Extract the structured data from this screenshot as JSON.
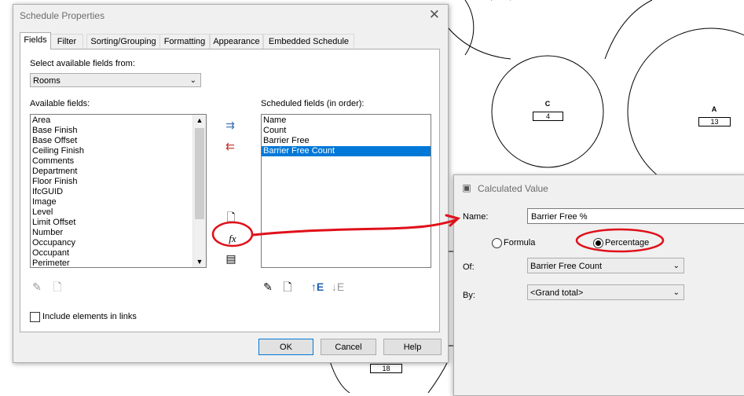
{
  "canvas": {
    "rooms": [
      {
        "name": "C",
        "number": "4"
      },
      {
        "name": "A",
        "number": "13"
      }
    ],
    "other_tags": [
      "18"
    ]
  },
  "schedule_dialog": {
    "title": "Schedule Properties",
    "tabs": [
      "Fields",
      "Filter",
      "Sorting/Grouping",
      "Formatting",
      "Appearance",
      "Embedded Schedule"
    ],
    "select_from_label": "Select available fields from:",
    "select_from_value": "Rooms",
    "available_label": "Available fields:",
    "available_fields": [
      "Area",
      "Base Finish",
      "Base Offset",
      "Ceiling Finish",
      "Comments",
      "Department",
      "Floor Finish",
      "IfcGUID",
      "Image",
      "Level",
      "Limit Offset",
      "Number",
      "Occupancy",
      "Occupant",
      "Perimeter"
    ],
    "scheduled_label": "Scheduled fields (in order):",
    "scheduled_fields": [
      "Name",
      "Count",
      "Barrier Free",
      "Barrier Free Count"
    ],
    "selected_scheduled": "Barrier Free Count",
    "include_links_label": "Include elements in links",
    "include_links_checked": false,
    "buttons": {
      "ok": "OK",
      "cancel": "Cancel",
      "help": "Help"
    }
  },
  "calc_dialog": {
    "title": "Calculated Value",
    "name_label": "Name:",
    "name_value": "Barrier Free %",
    "formula_label": "Formula",
    "percentage_label": "Percentage",
    "selected_mode": "Percentage",
    "of_label": "Of:",
    "of_value": "Barrier Free Count",
    "by_label": "By:",
    "by_value": "<Grand total>"
  },
  "colors": {
    "selection": "#0078d7",
    "annotation": "#e0101a"
  }
}
